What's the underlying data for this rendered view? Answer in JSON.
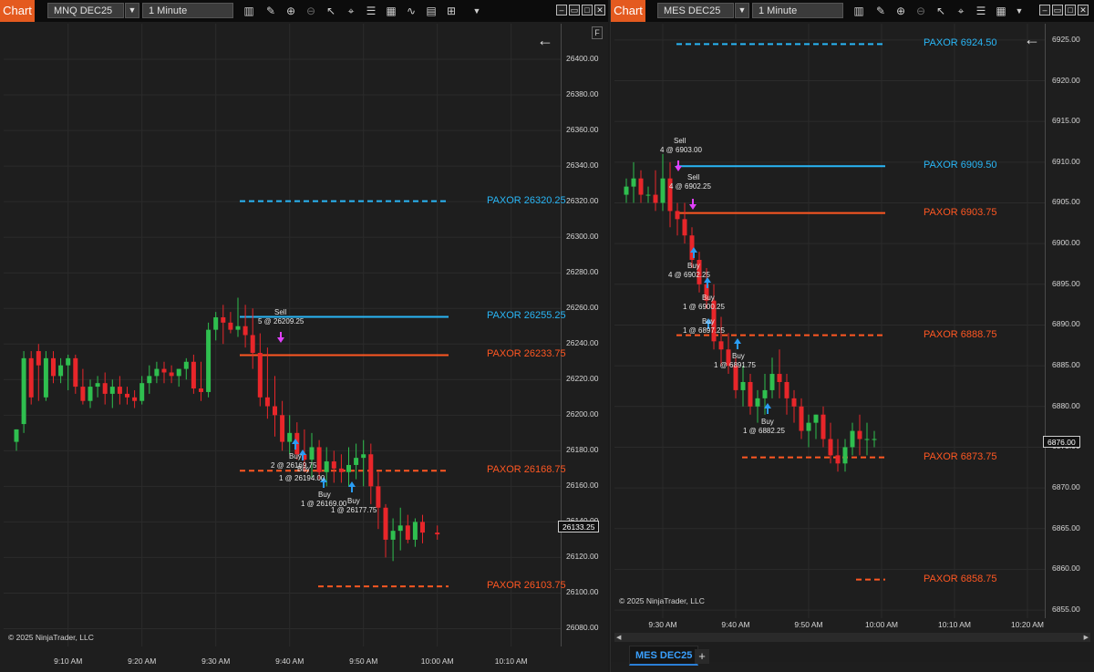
{
  "left": {
    "chart_label": "Chart",
    "instrument": "MNQ DEC25",
    "interval": "1 Minute",
    "copyright": "© 2025 NinjaTrader, LLC",
    "last_price": "26133.25",
    "f_label": "F",
    "y_ticks": [
      "26400.00",
      "26380.00",
      "26360.00",
      "26340.00",
      "26320.00",
      "26300.00",
      "26280.00",
      "26260.00",
      "26240.00",
      "26220.00",
      "26200.00",
      "26180.00",
      "26160.00",
      "26140.00",
      "26120.00",
      "26100.00",
      "26080.00"
    ],
    "x_ticks": [
      "9:10 AM",
      "9:20 AM",
      "9:30 AM",
      "9:40 AM",
      "9:50 AM",
      "10:00 AM",
      "10:10 AM"
    ],
    "levels": [
      {
        "label": "PAXOR 26320.25",
        "color": "#29b6f6"
      },
      {
        "label": "PAXOR 26255.25",
        "color": "#29b6f6"
      },
      {
        "label": "PAXOR 26233.75",
        "color": "#ff5722"
      },
      {
        "label": "PAXOR 26168.75",
        "color": "#ff5722"
      },
      {
        "label": "PAXOR 26103.75",
        "color": "#ff5722"
      }
    ],
    "annotations": [
      {
        "action": "Sell",
        "detail": "5 @ 26209.25"
      },
      {
        "action": "Buy",
        "detail": "2 @ 26169.75"
      },
      {
        "action": "Buy",
        "detail": "1 @ 26194.00"
      },
      {
        "action": "Buy",
        "detail": "1 @ 26169.00"
      },
      {
        "action": "Buy",
        "detail": "1 @ 26177.75"
      }
    ]
  },
  "right": {
    "chart_label": "Chart",
    "instrument": "MES DEC25",
    "interval": "1 Minute",
    "copyright": "© 2025 NinjaTrader, LLC",
    "last_price": "6876.00",
    "tab_label": "MES DEC25",
    "add_tab": "+",
    "y_ticks": [
      "6925.00",
      "6920.00",
      "6915.00",
      "6910.00",
      "6905.00",
      "6900.00",
      "6895.00",
      "6890.00",
      "6885.00",
      "6880.00",
      "6875.00",
      "6870.00",
      "6865.00",
      "6860.00",
      "6855.00"
    ],
    "x_ticks": [
      "9:30 AM",
      "9:40 AM",
      "9:50 AM",
      "10:00 AM",
      "10:10 AM",
      "10:20 AM"
    ],
    "levels": [
      {
        "label": "PAXOR 6924.50",
        "color": "#29b6f6"
      },
      {
        "label": "PAXOR 6909.50",
        "color": "#29b6f6"
      },
      {
        "label": "PAXOR 6903.75",
        "color": "#ff5722"
      },
      {
        "label": "PAXOR 6888.75",
        "color": "#ff5722"
      },
      {
        "label": "PAXOR 6873.75",
        "color": "#ff5722"
      },
      {
        "label": "PAXOR 6858.75",
        "color": "#ff5722"
      }
    ],
    "annotations": [
      {
        "action": "Sell",
        "detail": "4 @ 6903.00"
      },
      {
        "action": "Sell",
        "detail": "4 @ 6902.25"
      },
      {
        "action": "Buy",
        "detail": "4 @ 6902.25"
      },
      {
        "action": "Buy",
        "detail": "1 @ 6900.25"
      },
      {
        "action": "Buy",
        "detail": "1 @ 6897.25"
      },
      {
        "action": "Buy",
        "detail": "1 @ 6891.75"
      },
      {
        "action": "Buy",
        "detail": "1 @ 6882.25"
      }
    ]
  },
  "colors": {
    "up": "#2fbf4f",
    "down": "#e8262a",
    "bg": "#1e1e1e",
    "buy_arrow": "#2a9df4",
    "sell_arrow": "#e040fb"
  },
  "chart_data": [
    {
      "type": "candlestick",
      "instrument": "MNQ DEC25",
      "x": [
        "9:03",
        "9:04",
        "9:05",
        "9:06",
        "9:07",
        "9:08",
        "9:09",
        "9:10",
        "9:11",
        "9:12",
        "9:13",
        "9:14",
        "9:15",
        "9:16",
        "9:17",
        "9:18",
        "9:19",
        "9:20",
        "9:21",
        "9:22",
        "9:23",
        "9:24",
        "9:25",
        "9:26",
        "9:27",
        "9:28",
        "9:29",
        "9:30",
        "9:31",
        "9:32",
        "9:33",
        "9:34",
        "9:35",
        "9:36",
        "9:37",
        "9:38",
        "9:39",
        "9:40",
        "9:41",
        "9:42",
        "9:43",
        "9:44",
        "9:45",
        "9:46",
        "9:47",
        "9:48",
        "9:49",
        "9:50",
        "9:51",
        "9:52",
        "9:53",
        "9:54",
        "9:55",
        "9:56",
        "9:57",
        "9:58",
        "10:00"
      ],
      "open": [
        26185,
        26195,
        26232,
        26236,
        26210,
        26232,
        26222,
        26228,
        26232,
        26216,
        26208,
        26216,
        26218,
        26212,
        26216,
        26212,
        26210,
        26208,
        26218,
        26222,
        26226,
        26224,
        26222,
        26226,
        26230,
        26215,
        26213,
        26248,
        26255,
        26252,
        26248,
        26250,
        26245,
        26235,
        26210,
        26205,
        26200,
        26185,
        26190,
        26178,
        26175,
        26182,
        26168,
        26174,
        26170,
        26168,
        26172,
        26176,
        26178,
        26160,
        26148,
        26130,
        26135,
        26138,
        26130,
        26140,
        26134
      ],
      "high": [
        26192,
        26236,
        26236,
        26240,
        26236,
        26236,
        26232,
        26234,
        26234,
        26226,
        26220,
        26222,
        26224,
        26220,
        26222,
        26216,
        26214,
        26222,
        26228,
        26230,
        26230,
        26228,
        26226,
        26232,
        26234,
        26230,
        26252,
        26258,
        26262,
        26258,
        26266,
        26262,
        26260,
        26246,
        26238,
        26222,
        26208,
        26200,
        26196,
        26192,
        26190,
        26186,
        26182,
        26180,
        26178,
        26182,
        26184,
        26186,
        26184,
        26168,
        26150,
        26142,
        26148,
        26144,
        26142,
        26144,
        26138
      ],
      "low": [
        26180,
        26190,
        26206,
        26208,
        26208,
        26218,
        26218,
        26214,
        26212,
        26206,
        26204,
        26210,
        26206,
        26204,
        26206,
        26206,
        26204,
        26206,
        26212,
        26218,
        26218,
        26218,
        26216,
        26220,
        26212,
        26208,
        26210,
        26242,
        26240,
        26246,
        26244,
        26238,
        26226,
        26205,
        26198,
        26188,
        26180,
        26178,
        26175,
        26168,
        26165,
        26164,
        26160,
        26162,
        26162,
        26160,
        26164,
        26160,
        26150,
        26136,
        26120,
        26118,
        26124,
        26128,
        26126,
        26128,
        26130
      ],
      "close": [
        26192,
        26232,
        26210,
        26228,
        26232,
        26222,
        26228,
        26232,
        26216,
        26208,
        26216,
        26218,
        26212,
        26216,
        26212,
        26210,
        26208,
        26218,
        26222,
        26226,
        26224,
        26222,
        26226,
        26230,
        26215,
        26213,
        26248,
        26255,
        26252,
        26248,
        26250,
        26245,
        26235,
        26210,
        26205,
        26200,
        26185,
        26190,
        26178,
        26175,
        26182,
        26168,
        26174,
        26170,
        26168,
        26172,
        26176,
        26178,
        26160,
        26148,
        26130,
        26135,
        26138,
        26130,
        26140,
        26134,
        26133
      ],
      "ylim": [
        26070,
        26420
      ]
    },
    {
      "type": "candlestick",
      "instrument": "MES DEC25",
      "x": [
        "9:25",
        "9:26",
        "9:27",
        "9:28",
        "9:29",
        "9:30",
        "9:31",
        "9:32",
        "9:33",
        "9:34",
        "9:35",
        "9:36",
        "9:37",
        "9:38",
        "9:39",
        "9:40",
        "9:41",
        "9:42",
        "9:43",
        "9:44",
        "9:45",
        "9:46",
        "9:47",
        "9:48",
        "9:49",
        "9:50",
        "9:51",
        "9:52",
        "9:53",
        "9:54",
        "9:55",
        "9:56",
        "9:57",
        "9:58",
        "9:59"
      ],
      "open": [
        6906,
        6907,
        6908,
        6906,
        6906,
        6905,
        6908,
        6904,
        6903,
        6901,
        6898,
        6895,
        6893,
        6888,
        6887,
        6885,
        6882,
        6883,
        6880,
        6881,
        6882,
        6884,
        6883,
        6881,
        6880,
        6877,
        6878,
        6879,
        6876,
        6874,
        6873,
        6875,
        6877,
        6876,
        6876
      ],
      "high": [
        6908,
        6910,
        6909,
        6907,
        6909,
        6911,
        6910,
        6905,
        6905,
        6902,
        6899,
        6897,
        6895,
        6891,
        6889,
        6886,
        6885,
        6884,
        6882,
        6884,
        6886,
        6887,
        6884,
        6882,
        6881,
        6879,
        6879,
        6880,
        6878,
        6876,
        6876,
        6878,
        6879,
        6878,
        6877
      ],
      "low": [
        6905,
        6905,
        6905,
        6905,
        6904,
        6904,
        6902,
        6901,
        6900,
        6897,
        6894,
        6892,
        6887,
        6885,
        6884,
        6881,
        6880,
        6879,
        6878,
        6879,
        6881,
        6881,
        6879,
        6878,
        6876,
        6875,
        6876,
        6875,
        6873,
        6872,
        6872,
        6874,
        6874,
        6874,
        6875
      ],
      "close": [
        6907,
        6908,
        6906,
        6906,
        6905,
        6908,
        6904,
        6903,
        6901,
        6898,
        6895,
        6893,
        6888,
        6887,
        6885,
        6882,
        6883,
        6880,
        6881,
        6882,
        6884,
        6883,
        6881,
        6880,
        6877,
        6878,
        6879,
        6876,
        6874,
        6873,
        6875,
        6877,
        6876,
        6876,
        6876
      ],
      "ylim": [
        6854,
        6927
      ]
    }
  ]
}
